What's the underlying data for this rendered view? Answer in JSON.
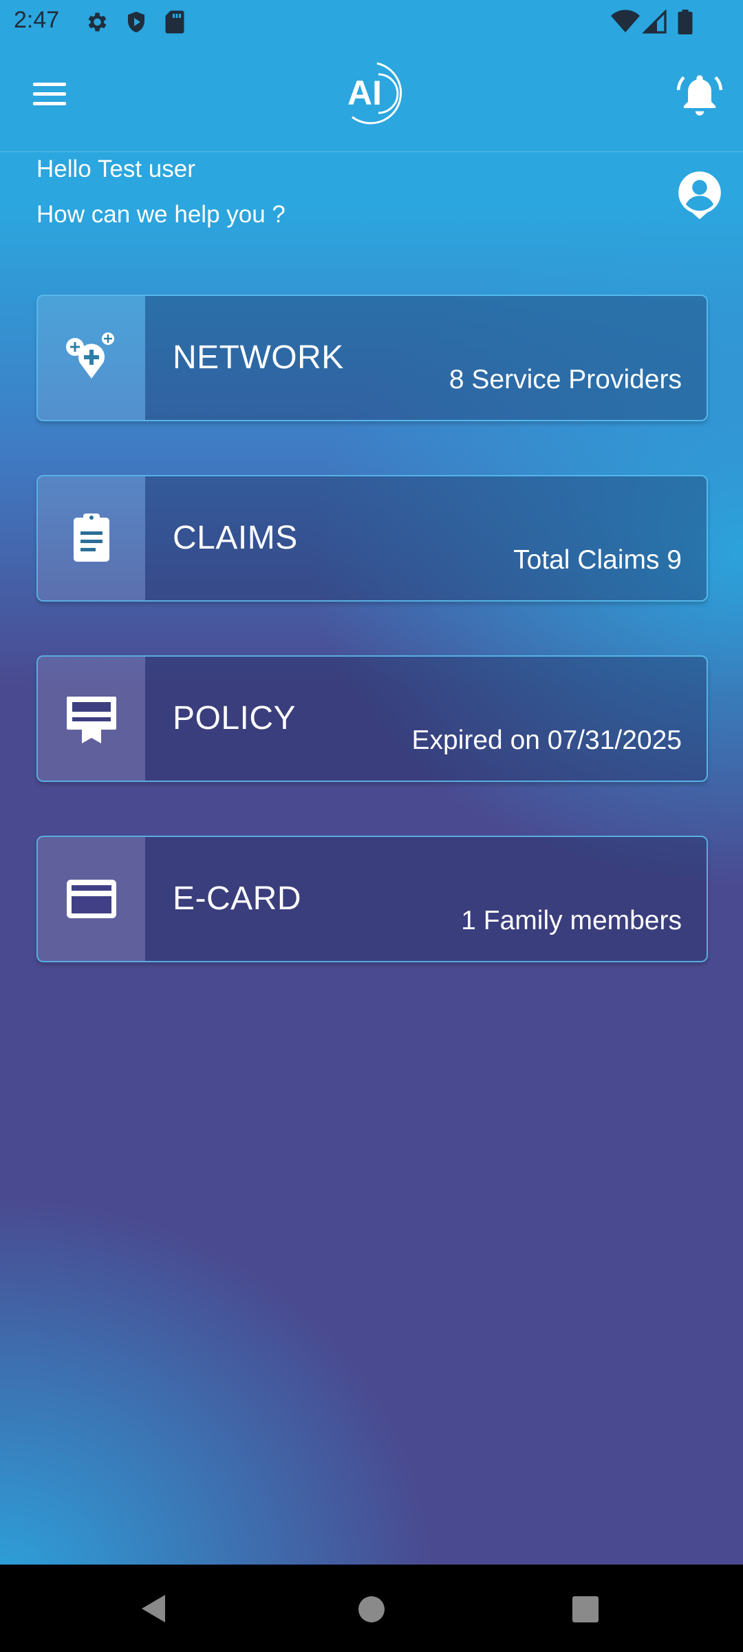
{
  "status_bar": {
    "time": "2:47",
    "left_icons": [
      "gear-icon",
      "shield-play-icon",
      "sd-card-icon"
    ],
    "right_icons": [
      "wifi-icon",
      "cell-signal-icon",
      "battery-icon"
    ]
  },
  "app_bar": {
    "logo_text": "AI",
    "menu_icon": "hamburger-menu-icon",
    "bell_icon": "bell-alert-icon"
  },
  "greeting": {
    "line1": "Hello Test user",
    "line2": "How can we help you ?"
  },
  "cards": [
    {
      "title": "NETWORK",
      "subtitle": "8 Service Providers",
      "icon": "location-plus-icon"
    },
    {
      "title": "CLAIMS",
      "subtitle": "Total Claims 9",
      "icon": "clipboard-icon"
    },
    {
      "title": "POLICY",
      "subtitle": "Expired on 07/31/2025",
      "icon": "certificate-icon"
    },
    {
      "title": "E-CARD",
      "subtitle": "1 Family members",
      "icon": "credit-card-icon"
    }
  ],
  "nav_bar": {
    "buttons": [
      "back-icon",
      "home-icon",
      "recents-icon"
    ]
  },
  "colors": {
    "top_blue": "#2ba6de",
    "purple": "#4a4a90",
    "text": "#ffffff",
    "nav_bg": "#000000"
  }
}
